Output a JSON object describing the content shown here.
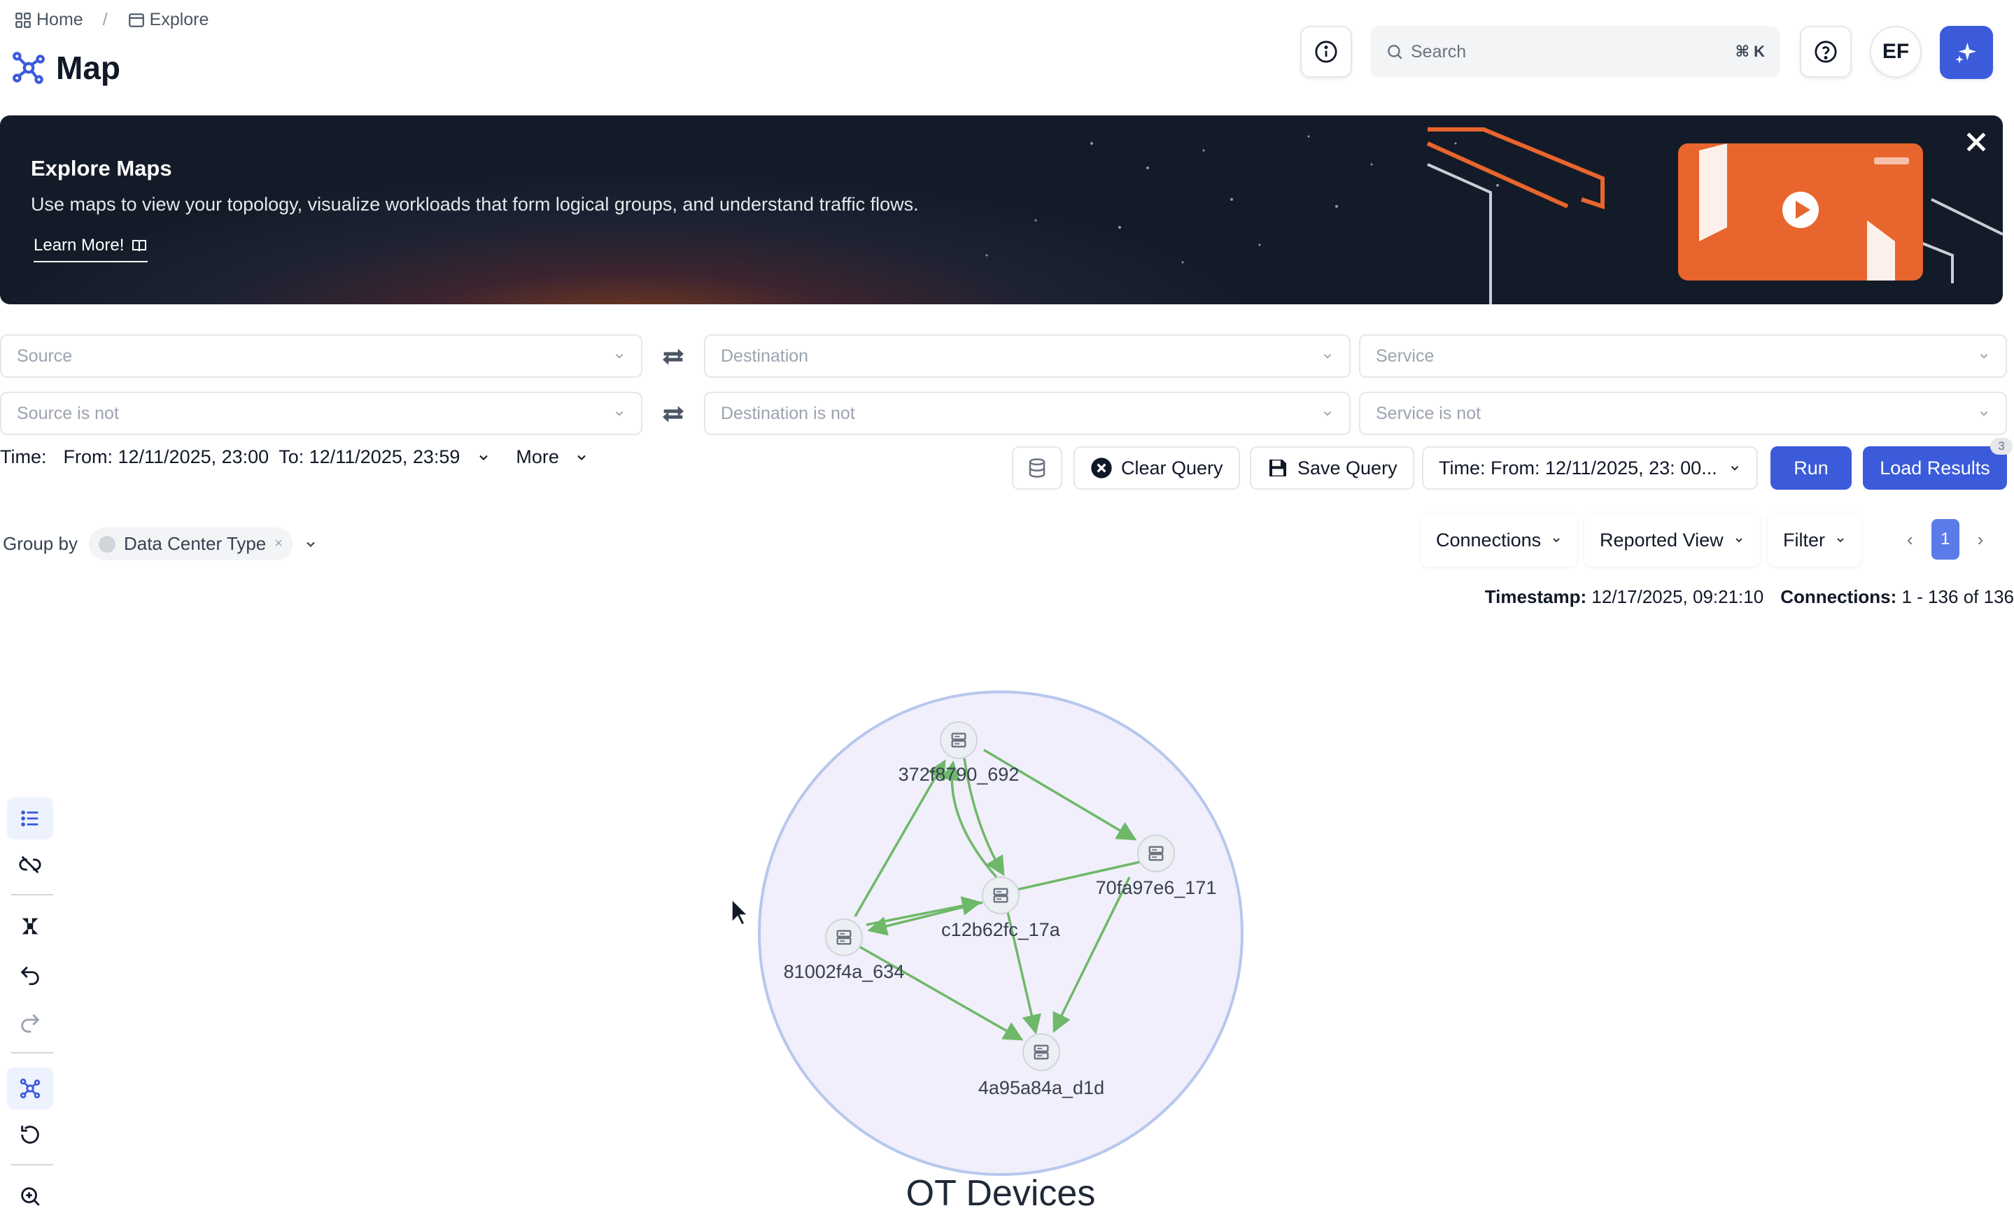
{
  "breadcrumb": {
    "home": "Home",
    "separator": "/",
    "explore": "Explore"
  },
  "page": {
    "title": "Map"
  },
  "header": {
    "search_placeholder": "Search",
    "search_shortcut": "⌘ K",
    "avatar": "EF"
  },
  "banner": {
    "title": "Explore Maps",
    "description": "Use maps to view your topology, visualize workloads that form logical groups, and understand traffic flows.",
    "link": "Learn More!"
  },
  "filters": {
    "source": "Source",
    "destination": "Destination",
    "service": "Service",
    "source_not": "Source is not",
    "destination_not": "Destination is not",
    "service_not": "Service is not"
  },
  "timebar": {
    "label": "Time:",
    "from": "From: 12/11/2025, 23:00",
    "to": "To: 12/11/2025, 23:59",
    "more": "More"
  },
  "actions": {
    "clear": "Clear Query",
    "save": "Save Query",
    "time_select": "Time: From: 12/11/2025, 23: 00...",
    "run": "Run",
    "load": "Load Results",
    "load_badge": "3"
  },
  "groupby": {
    "label": "Group by",
    "chip": "Data Center Type",
    "chip_remove": "×"
  },
  "view_controls": {
    "connections": "Connections",
    "reported": "Reported View",
    "filter": "Filter"
  },
  "pagination": {
    "prev": "‹",
    "current": "1",
    "next": "›"
  },
  "stats": {
    "timestamp_label": "Timestamp:",
    "timestamp_value": "12/17/2025, 09:21:10",
    "connections_label": "Connections:",
    "connections_value": "1 - 136 of 136"
  },
  "map": {
    "group_label": "OT Devices",
    "nodes": [
      {
        "id": "372f8790_692",
        "label": "372f8790_692"
      },
      {
        "id": "70fa97e6_171",
        "label": "70fa97e6_171"
      },
      {
        "id": "c12b62fc_17a",
        "label": "c12b62fc_17a"
      },
      {
        "id": "81002f4a_634",
        "label": "81002f4a_634"
      },
      {
        "id": "4a95a84a_d1d",
        "label": "4a95a84a_d1d"
      }
    ],
    "edge_color": "#6fb86a",
    "group_fill": "#f1effb",
    "group_stroke": "#b7c7ee"
  },
  "colors": {
    "primary": "#3b5bdb",
    "banner_card": "#e8652d"
  }
}
